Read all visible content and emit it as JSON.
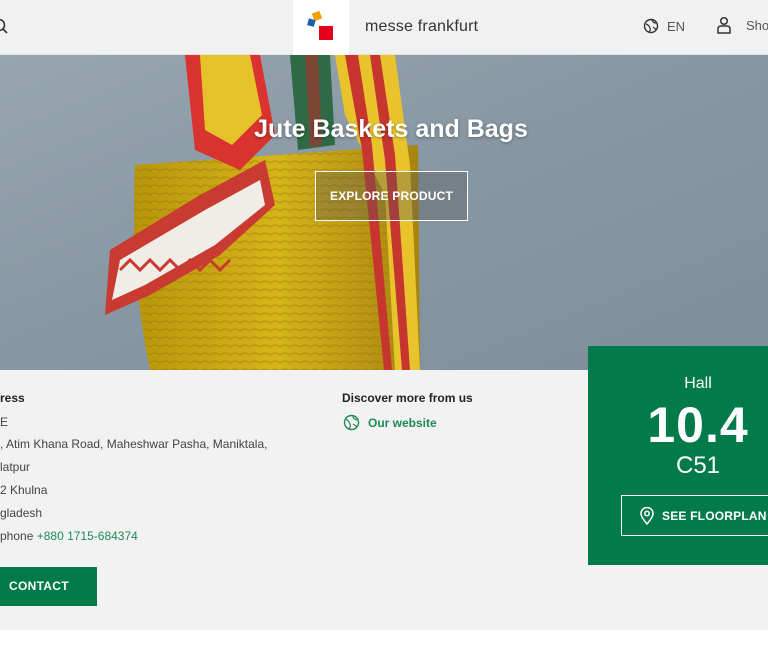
{
  "header": {
    "brand": "messe frankfurt",
    "language": "EN",
    "user_label": "Sho"
  },
  "hero": {
    "title": "Jute Baskets and Bags",
    "cta": "EXPLORE PRODUCT"
  },
  "address": {
    "title": "ress",
    "lines": [
      "E",
      ", Atim Khana Road, Maheshwar Pasha, Maniktala,",
      "latpur",
      "2 Khulna",
      "gladesh"
    ],
    "phone_label": "phone",
    "phone_value": "+880 1715-684374"
  },
  "discover": {
    "title": "Discover more from us",
    "website": "Our website"
  },
  "contact_button": "CONTACT",
  "hall": {
    "label": "Hall",
    "number": "10.4",
    "stand": "C51",
    "floorplan_button": "SEE FLOORPLAN"
  },
  "colors": {
    "brand_green": "#027a4a",
    "link_green": "#1e8a5a",
    "header_bg": "#f1f1f1"
  },
  "icons": [
    "search-icon",
    "messe-frankfurt-logo",
    "globe-icon",
    "user-icon",
    "location-pin-icon"
  ]
}
